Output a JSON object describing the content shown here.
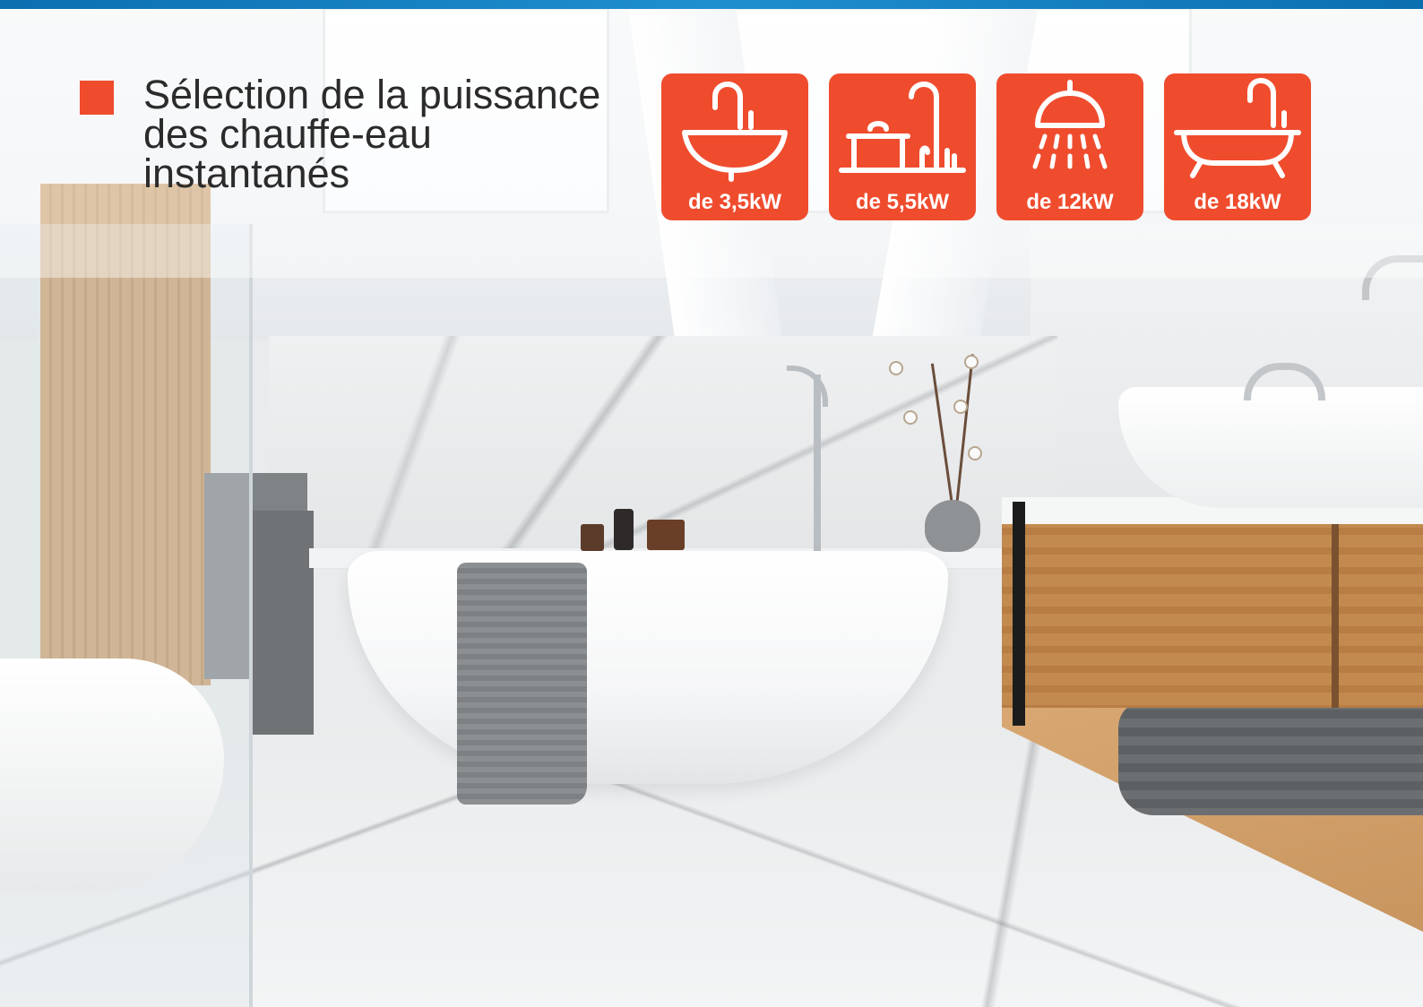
{
  "header": {
    "title": "Sélection de la puissance des chauffe-eau instantanés",
    "accent_color": "#ef4c2e",
    "top_bar_color": "#0b6fb0"
  },
  "badges": [
    {
      "icon": "washbasin-icon",
      "label": "de 3,5kW"
    },
    {
      "icon": "kitchen-sink-pot-icon",
      "label": "de 5,5kW"
    },
    {
      "icon": "shower-head-icon",
      "label": "de 12kW"
    },
    {
      "icon": "bathtub-icon",
      "label": "de 18kW"
    }
  ]
}
